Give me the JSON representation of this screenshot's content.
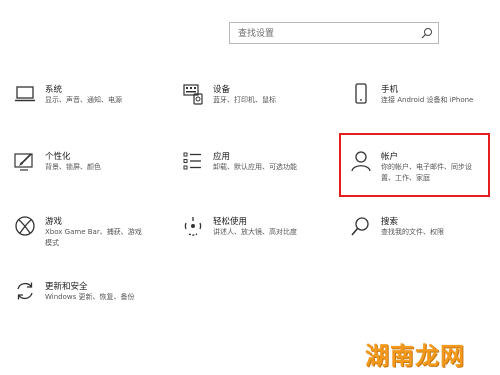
{
  "search": {
    "placeholder": "查找设置"
  },
  "items": [
    {
      "title": "系统",
      "desc": "显示、声音、通知、电源",
      "icon": "laptop-icon"
    },
    {
      "title": "设备",
      "desc": "蓝牙、打印机、鼠标",
      "icon": "keyboard-printer-icon"
    },
    {
      "title": "手机",
      "desc": "连接 Android 设备和 iPhone",
      "icon": "phone-icon"
    },
    {
      "title": "个性化",
      "desc": "背景、锁屏、颜色",
      "icon": "paint-icon"
    },
    {
      "title": "应用",
      "desc": "卸载、默认应用、可选功能",
      "icon": "apps-list-icon"
    },
    {
      "title": "帐户",
      "desc_lines": [
        "你的帐户、电子邮件、同步设",
        "置、工作、家庭"
      ],
      "icon": "person-icon"
    },
    {
      "title": "游戏",
      "desc_lines": [
        "Xbox Game Bar、捕获、游戏",
        "模式"
      ],
      "icon": "xbox-icon"
    },
    {
      "title": "轻松使用",
      "desc": "讲述人、放大镜、高对比度",
      "icon": "ease-of-access-icon"
    },
    {
      "title": "搜索",
      "desc": "查找我的文件、权限",
      "icon": "search-icon"
    },
    {
      "title": "更新和安全",
      "desc": "Windows 更新、恢复、备份",
      "icon": "update-icon"
    }
  ],
  "watermark": "湖南龙网",
  "colors": {
    "highlight": "#e51d1d",
    "watermark": "#f39a1e"
  }
}
